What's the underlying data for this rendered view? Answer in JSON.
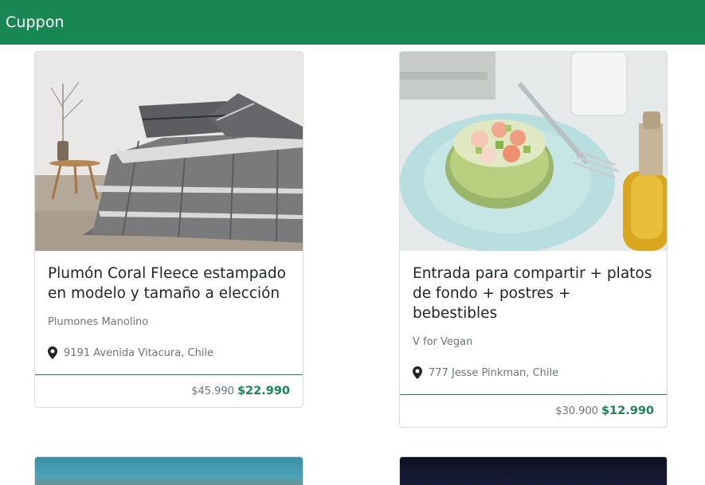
{
  "navbar": {
    "brand": "Cuppon"
  },
  "deals": [
    {
      "title": "Plumón Coral Fleece estampado en modelo y tamaño a elección",
      "merchant": "Plumones Manolino",
      "location": "9191 Avenida Vitacura, Chile",
      "old_price": "$45.990",
      "new_price": "$22.990",
      "image": "bedroom-comforter-photo"
    },
    {
      "title": "Entrada para compartir + platos de fondo + postres + bebestibles",
      "merchant": "V for Vegan",
      "location": "777 Jesse Pinkman, Chile",
      "old_price": "$30.900",
      "new_price": "$12.990",
      "image": "avocado-shrimp-plate-photo"
    }
  ],
  "colors": {
    "brand": "#198754",
    "muted": "#6c757d",
    "text": "#212529"
  },
  "icons": {
    "location": "map-pin-icon"
  }
}
